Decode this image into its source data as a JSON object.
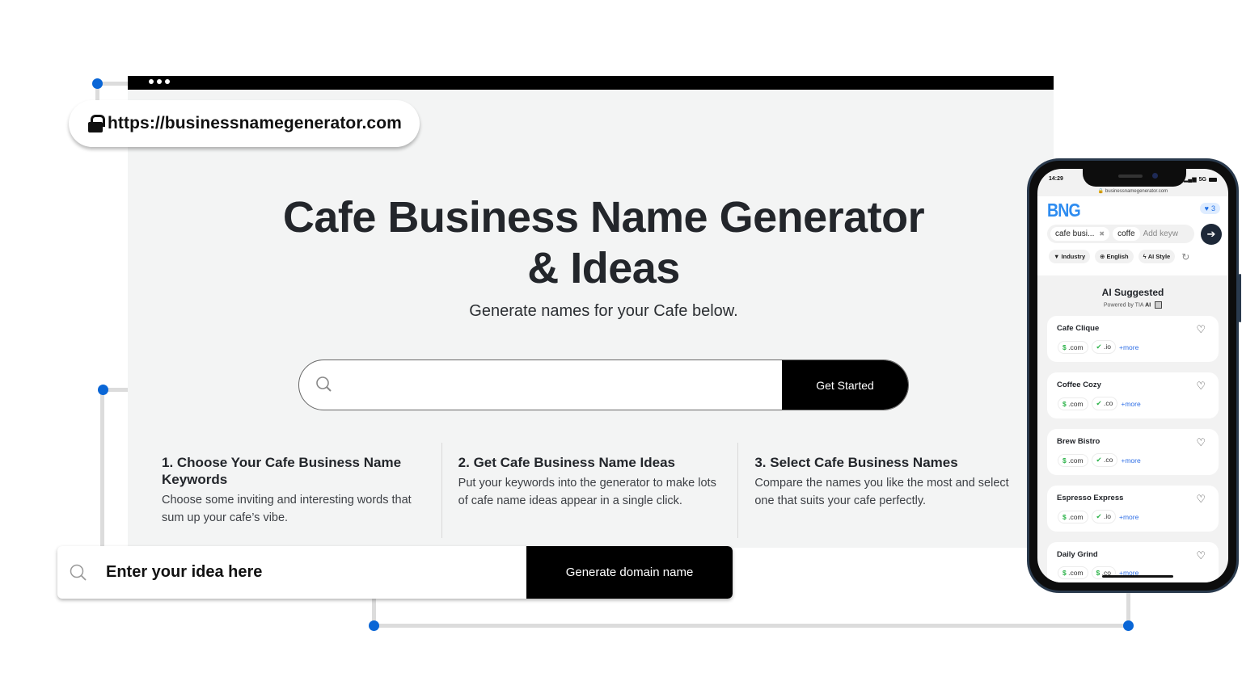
{
  "browser": {
    "url": "https://businessnamegenerator.com"
  },
  "hero": {
    "title_line1": "Cafe Business Name Generator",
    "title_line2": "& Ideas",
    "subtitle": "Generate names for your Cafe below."
  },
  "main_search": {
    "value": "",
    "button_label": "Get Started"
  },
  "steps": [
    {
      "title": "1. Choose Your Cafe Business Name Keywords",
      "description": "Choose some inviting and interesting words that sum up your cafe’s vibe."
    },
    {
      "title": "2. Get Cafe Business Name Ideas",
      "description": "Put your keywords into the generator to make lots of cafe name ideas appear in a single click."
    },
    {
      "title": "3. Select Cafe Business Names",
      "description": "Compare the names you like the most and select one that suits your cafe perfectly."
    }
  ],
  "floating_search": {
    "placeholder": "Enter your idea here",
    "button_label": "Generate domain name"
  },
  "phone": {
    "time": "14:29",
    "network": "5G",
    "address": "businessnamegenerator.com",
    "logo": "BNG",
    "favorites_count": "3",
    "keywords": [
      "cafe busi...",
      "coffe"
    ],
    "keyword_placeholder": "Add keyw",
    "filters": [
      "Industry",
      "English",
      "AI Style"
    ],
    "section_title": "AI Suggested",
    "powered_by_prefix": "Powered by TIA",
    "powered_by_bold": "AI",
    "results": [
      {
        "name": "Cafe Clique",
        "tags": [
          {
            "icon": "$",
            "ext": ".com"
          },
          {
            "icon": "✔",
            "ext": ".io"
          }
        ],
        "more": "+more"
      },
      {
        "name": "Coffee Cozy",
        "tags": [
          {
            "icon": "$",
            "ext": ".com"
          },
          {
            "icon": "✔",
            "ext": ".co"
          }
        ],
        "more": "+more"
      },
      {
        "name": "Brew Bistro",
        "tags": [
          {
            "icon": "$",
            "ext": ".com"
          },
          {
            "icon": "✔",
            "ext": ".co"
          }
        ],
        "more": "+more"
      },
      {
        "name": "Espresso Express",
        "tags": [
          {
            "icon": "$",
            "ext": ".com"
          },
          {
            "icon": "✔",
            "ext": ".io"
          }
        ],
        "more": "+more"
      },
      {
        "name": "Daily Grind",
        "tags": [
          {
            "icon": "$",
            "ext": ".com"
          },
          {
            "icon": "$",
            "ext": ".co"
          }
        ],
        "more": "+more"
      }
    ]
  },
  "colors": {
    "accent_blue": "#0a66d6",
    "logo_blue": "#2e8cf0",
    "available_green": "#2db34a",
    "button_black": "#000000"
  }
}
